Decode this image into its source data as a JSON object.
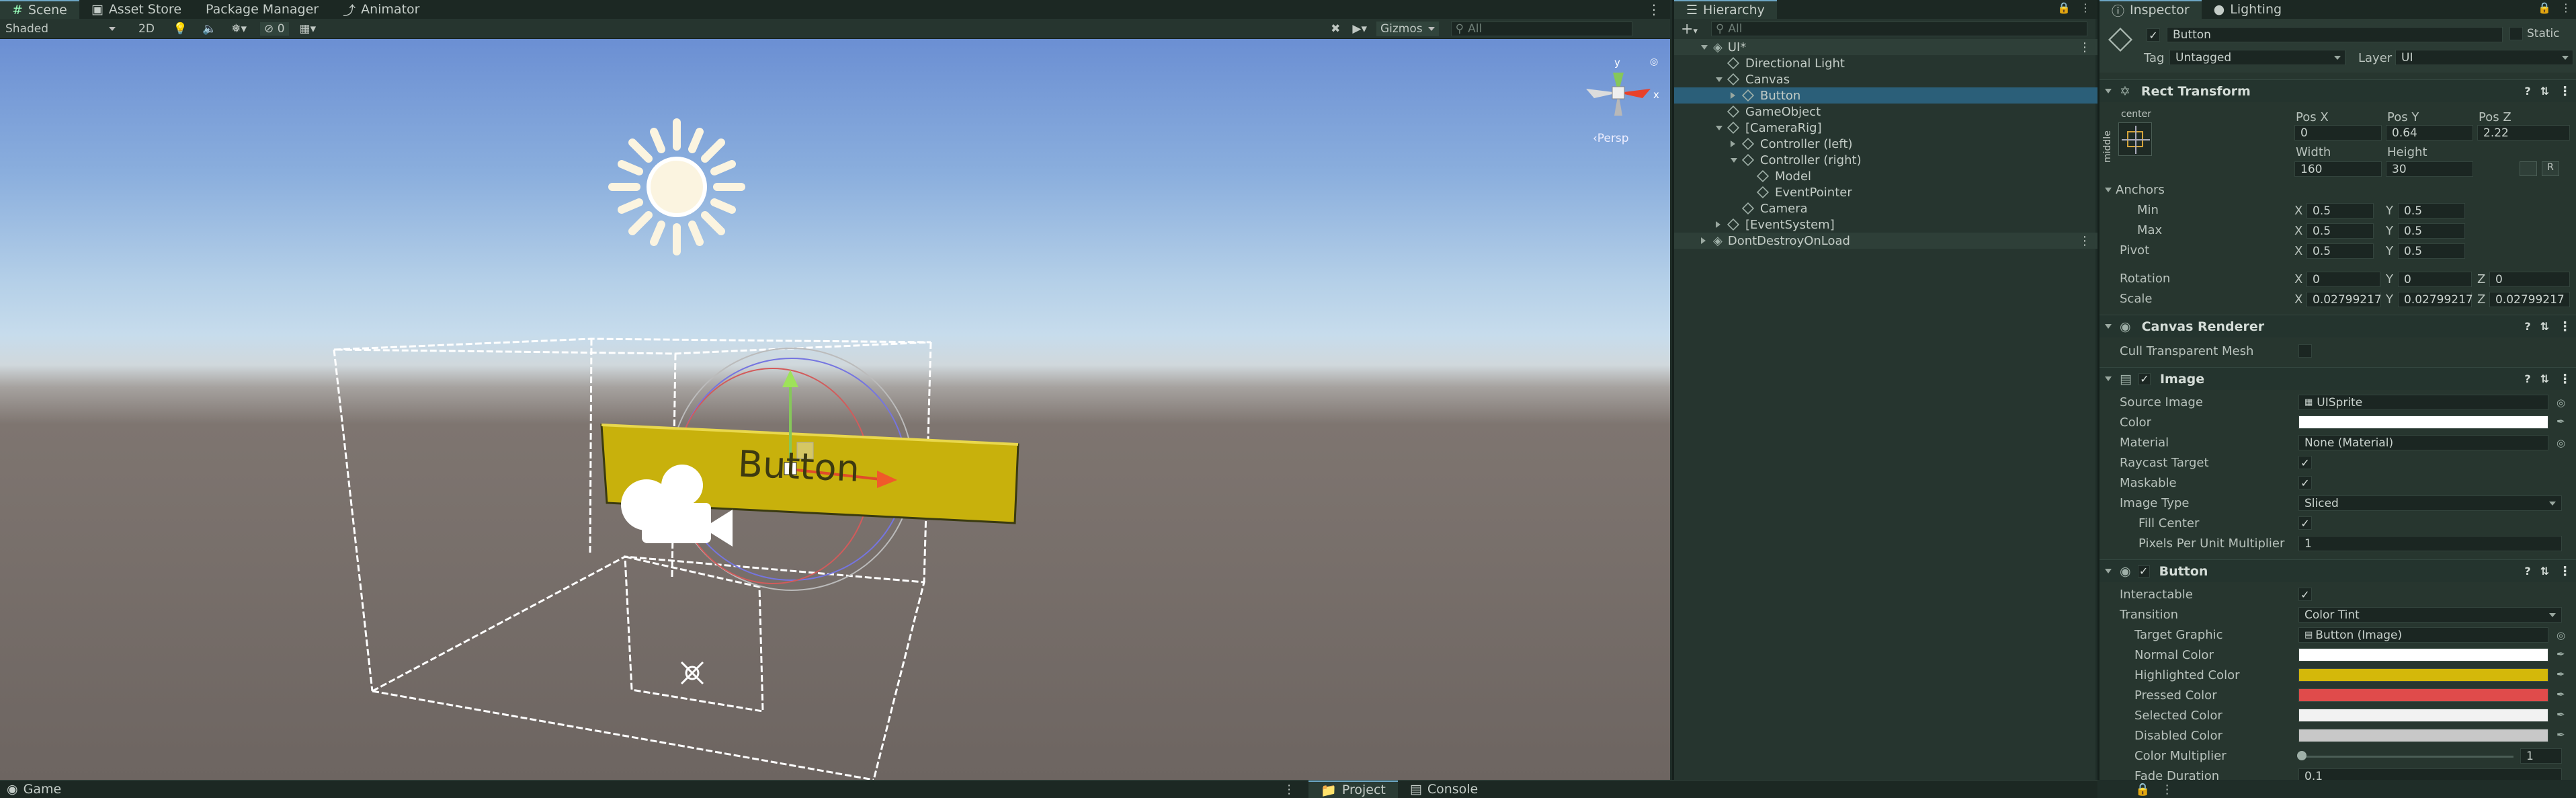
{
  "scene": {
    "tabs": [
      {
        "label": "Scene"
      },
      {
        "label": "Asset Store"
      },
      {
        "label": "Package Manager"
      },
      {
        "label": "Animator"
      }
    ],
    "shading_mode": "Shaded",
    "mode_2d": "2D",
    "gizmos_label": "Gizmos",
    "search_placeholder": "All",
    "fx_count": "0",
    "persp_label": "‹Persp",
    "axis_y": "y",
    "axis_x": "x",
    "button_text": "Button"
  },
  "hierarchy": {
    "title": "Hierarchy",
    "search_placeholder": "All",
    "items": [
      {
        "label": "UI*",
        "depth": 0,
        "expand": "down",
        "icon": "unity-scene-icon",
        "selected": false,
        "scene": true
      },
      {
        "label": "Directional Light",
        "depth": 1,
        "expand": "none",
        "icon": "gameobject-icon",
        "selected": false
      },
      {
        "label": "Canvas",
        "depth": 1,
        "expand": "down",
        "icon": "gameobject-icon",
        "selected": false
      },
      {
        "label": "Button",
        "depth": 2,
        "expand": "right",
        "icon": "gameobject-icon",
        "selected": true
      },
      {
        "label": "GameObject",
        "depth": 1,
        "expand": "none",
        "icon": "gameobject-icon",
        "selected": false
      },
      {
        "label": "[CameraRig]",
        "depth": 1,
        "expand": "down",
        "icon": "gameobject-icon",
        "selected": false
      },
      {
        "label": "Controller (left)",
        "depth": 2,
        "expand": "right",
        "icon": "gameobject-icon",
        "selected": false
      },
      {
        "label": "Controller (right)",
        "depth": 2,
        "expand": "down",
        "icon": "gameobject-icon",
        "selected": false
      },
      {
        "label": "Model",
        "depth": 3,
        "expand": "none",
        "icon": "gameobject-icon",
        "selected": false
      },
      {
        "label": "EventPointer",
        "depth": 3,
        "expand": "none",
        "icon": "gameobject-icon",
        "selected": false
      },
      {
        "label": "Camera",
        "depth": 2,
        "expand": "none",
        "icon": "gameobject-icon",
        "selected": false
      },
      {
        "label": "[EventSystem]",
        "depth": 1,
        "expand": "right",
        "icon": "gameobject-icon",
        "selected": false
      },
      {
        "label": "DontDestroyOnLoad",
        "depth": 0,
        "expand": "right",
        "icon": "unity-scene-icon",
        "selected": false,
        "scene": true
      }
    ]
  },
  "inspector": {
    "tabs": [
      {
        "label": "Inspector"
      },
      {
        "label": "Lighting"
      }
    ],
    "object_name": "Button",
    "static_label": "Static",
    "tag_label": "Tag",
    "tag_value": "Untagged",
    "layer_label": "Layer",
    "layer_value": "UI",
    "rect": {
      "title": "Rect Transform",
      "anchor_h": "center",
      "anchor_v": "middle",
      "pos_x_label": "Pos X",
      "pos_y_label": "Pos Y",
      "pos_z_label": "Pos Z",
      "pos_x": "0",
      "pos_y": "0.64",
      "pos_z": "2.22",
      "width_label": "Width",
      "height_label": "Height",
      "width": "160",
      "height": "30",
      "anchors_label": "Anchors",
      "min_label": "Min",
      "max_label": "Max",
      "min_x": "0.5",
      "min_y": "0.5",
      "max_x": "0.5",
      "max_y": "0.5",
      "pivot_label": "Pivot",
      "pivot_x": "0.5",
      "pivot_y": "0.5",
      "rotation_label": "Rotation",
      "rot_x": "0",
      "rot_y": "0",
      "rot_z": "0",
      "scale_label": "Scale",
      "scale_x": "0.02799217",
      "scale_y": "0.02799217",
      "scale_z": "0.02799217",
      "x": "X",
      "y": "Y",
      "z": "Z",
      "r_button": "R"
    },
    "canvas_renderer": {
      "title": "Canvas Renderer",
      "cull_label": "Cull Transparent Mesh"
    },
    "image": {
      "title": "Image",
      "source_label": "Source Image",
      "source_value": "UISprite",
      "color_label": "Color",
      "material_label": "Material",
      "material_value": "None (Material)",
      "raycast_label": "Raycast Target",
      "maskable_label": "Maskable",
      "type_label": "Image Type",
      "type_value": "Sliced",
      "fill_label": "Fill Center",
      "ppu_label": "Pixels Per Unit Multiplier",
      "ppu_value": "1"
    },
    "button": {
      "title": "Button",
      "interactable_label": "Interactable",
      "transition_label": "Transition",
      "transition_value": "Color Tint",
      "target_label": "Target Graphic",
      "target_value": "Button (Image)",
      "normal_label": "Normal Color",
      "highlighted_label": "Highlighted Color",
      "pressed_label": "Pressed Color",
      "selected_label": "Selected Color",
      "disabled_label": "Disabled Color",
      "multiplier_label": "Color Multiplier",
      "multiplier_value": "1",
      "fade_label": "Fade Duration",
      "fade_value": "0.1",
      "colors": {
        "normal": "#ffffff",
        "highlighted": "#d4b80a",
        "pressed": "#e04b4b",
        "selected": "#f2f2f2",
        "disabled": "#c8c8c8"
      }
    }
  },
  "bottom": {
    "game_tab": "Game",
    "project_tab": "Project",
    "console_tab": "Console"
  },
  "colors": {
    "accent": "#2b5f79",
    "button_fill": "#c8b10c",
    "sky_top": "#6e8fd0",
    "ground": "#6e6663"
  }
}
